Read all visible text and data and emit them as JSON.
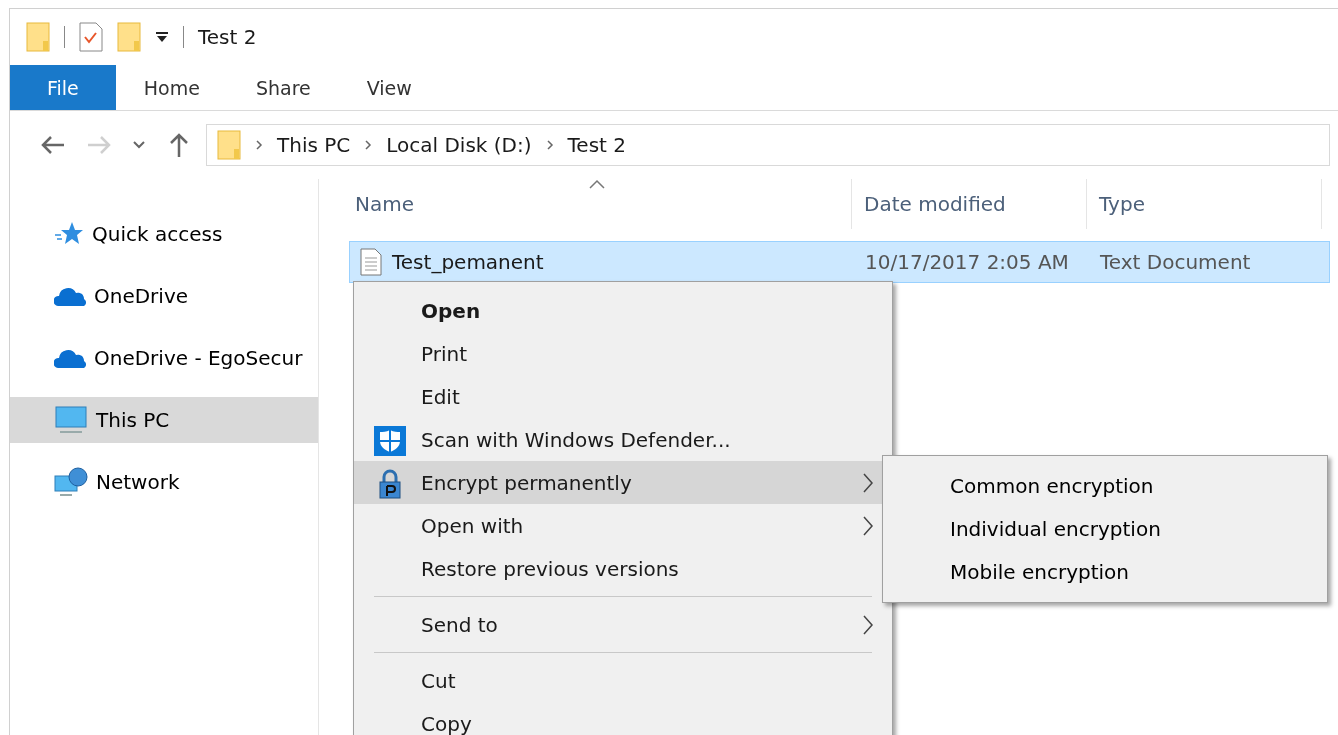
{
  "window": {
    "title": "Test 2"
  },
  "quick_access_toolbar": [
    {
      "kind": "folder"
    },
    {
      "kind": "separator"
    },
    {
      "kind": "properties"
    },
    {
      "kind": "new-folder"
    },
    {
      "kind": "customize"
    },
    {
      "kind": "separator"
    }
  ],
  "ribbon_tabs": [
    {
      "label": "File",
      "selected": true
    },
    {
      "label": "Home",
      "selected": false
    },
    {
      "label": "Share",
      "selected": false
    },
    {
      "label": "View",
      "selected": false
    }
  ],
  "navigation": [
    {
      "kind": "back",
      "disabled": false
    },
    {
      "kind": "forward",
      "disabled": true
    },
    {
      "kind": "recent",
      "disabled": false
    },
    {
      "kind": "up",
      "disabled": false
    }
  ],
  "address_bar": {
    "path": [
      "This PC",
      "Local Disk (D:)",
      "Test 2"
    ]
  },
  "sidebar": {
    "items": [
      {
        "label": "Quick access",
        "kind": "star",
        "selected": false
      },
      {
        "label": "OneDrive",
        "kind": "cloud",
        "selected": false
      },
      {
        "label": "OneDrive - EgoSecur",
        "kind": "cloud",
        "selected": false
      },
      {
        "label": "This PC",
        "kind": "pc",
        "selected": true
      },
      {
        "label": "Network",
        "kind": "network",
        "selected": false
      }
    ]
  },
  "table": {
    "columns": [
      {
        "label": "Name",
        "sorted": true
      },
      {
        "label": "Date modified",
        "sorted": false
      },
      {
        "label": "Type",
        "sorted": false
      }
    ],
    "rows": [
      {
        "name": "Test_pemanent",
        "date_modified": "10/17/2017 2:05 AM",
        "type": "Text Document",
        "selected": true
      }
    ]
  },
  "context_menu": {
    "items": [
      {
        "kind": "item",
        "label": "Open",
        "bold": true,
        "highlighted": false,
        "submenu": false
      },
      {
        "kind": "item",
        "label": "Print",
        "bold": false,
        "highlighted": false,
        "submenu": false
      },
      {
        "kind": "item",
        "label": "Edit",
        "bold": false,
        "highlighted": false,
        "submenu": false
      },
      {
        "kind": "shield",
        "label": "Scan with Windows Defender...",
        "bold": false,
        "highlighted": false,
        "submenu": false
      },
      {
        "kind": "lock",
        "label": "Encrypt permanently",
        "bold": false,
        "highlighted": true,
        "submenu": true
      },
      {
        "kind": "item",
        "label": "Open with",
        "bold": false,
        "highlighted": false,
        "submenu": true
      },
      {
        "kind": "item",
        "label": "Restore previous versions",
        "bold": false,
        "highlighted": false,
        "submenu": false
      },
      {
        "kind": "separator"
      },
      {
        "kind": "item",
        "label": "Send to",
        "bold": false,
        "highlighted": false,
        "submenu": true
      },
      {
        "kind": "separator"
      },
      {
        "kind": "item",
        "label": "Cut",
        "bold": false,
        "highlighted": false,
        "submenu": false
      },
      {
        "kind": "item",
        "label": "Copy",
        "bold": false,
        "highlighted": false,
        "submenu": false
      }
    ]
  },
  "submenu": {
    "items": [
      {
        "label": "Common encryption"
      },
      {
        "label": "Individual encryption"
      },
      {
        "label": "Mobile encryption"
      }
    ]
  }
}
